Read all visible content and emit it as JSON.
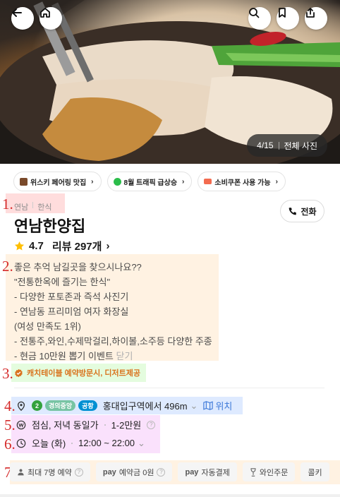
{
  "hero": {
    "counter": "4/15",
    "all_photos_label": "전체 사진"
  },
  "chips": [
    {
      "label": "위스키 페어링 맛집",
      "icon": "whiskey-icon",
      "color": "#7a4a2a"
    },
    {
      "label": "8월 트래픽 급상승",
      "icon": "trend-icon",
      "color": "#2bbd4a"
    },
    {
      "label": "소비쿠폰 사용 가능",
      "icon": "coupon-icon",
      "color": "#f36b4f"
    }
  ],
  "markers": [
    "1.",
    "2.",
    "3.",
    "4.",
    "5.",
    "6.",
    "7."
  ],
  "place": {
    "area": "연남",
    "category": "한식",
    "name": "연남한양집",
    "call_label": "전화",
    "rating": "4.7",
    "reviews": "리뷰 297개"
  },
  "description": {
    "lines": [
      "좋은 추억 남길곳을 찾으시나요??",
      "\"전통한옥에 즐기는 한식\"",
      "- 다양한 포토존과 즉석 사진기",
      "- 연남동 프리미엄 여자 화장실",
      "(여성 만족도 1위)",
      "- 전통주,와인,수제막걸리,하이볼,소주등 다양한 주종",
      "- 현금 10만원 뽑기 이벤트"
    ],
    "close_label": "닫기"
  },
  "perk": "캐치테이블 예약방문시, 디저트제공",
  "location": {
    "line_number": "2",
    "line_name": "경의중앙",
    "airport": "공항",
    "text": "홍대입구역에서 496m",
    "map_label": "위치",
    "colors": {
      "line2": "#33a23d",
      "gyeongui": "#77c4a3",
      "airport": "#0090d2"
    }
  },
  "price": {
    "meal": "점심, 저녁 동일가",
    "range": "1-2만원"
  },
  "hours": {
    "day": "오늘 (화)",
    "time": "12:00 ~ 22:00"
  },
  "tags": [
    {
      "prefix": "",
      "label": "최대 7명 예약",
      "help": true
    },
    {
      "prefix": "pay",
      "label": "예약금 0원",
      "help": true
    },
    {
      "prefix": "pay",
      "label": "자동결제",
      "help": false
    },
    {
      "prefix": "",
      "label": "와인주문",
      "help": false
    },
    {
      "prefix": "",
      "label": "콜키",
      "help": false
    }
  ],
  "accent": "#d9731e"
}
